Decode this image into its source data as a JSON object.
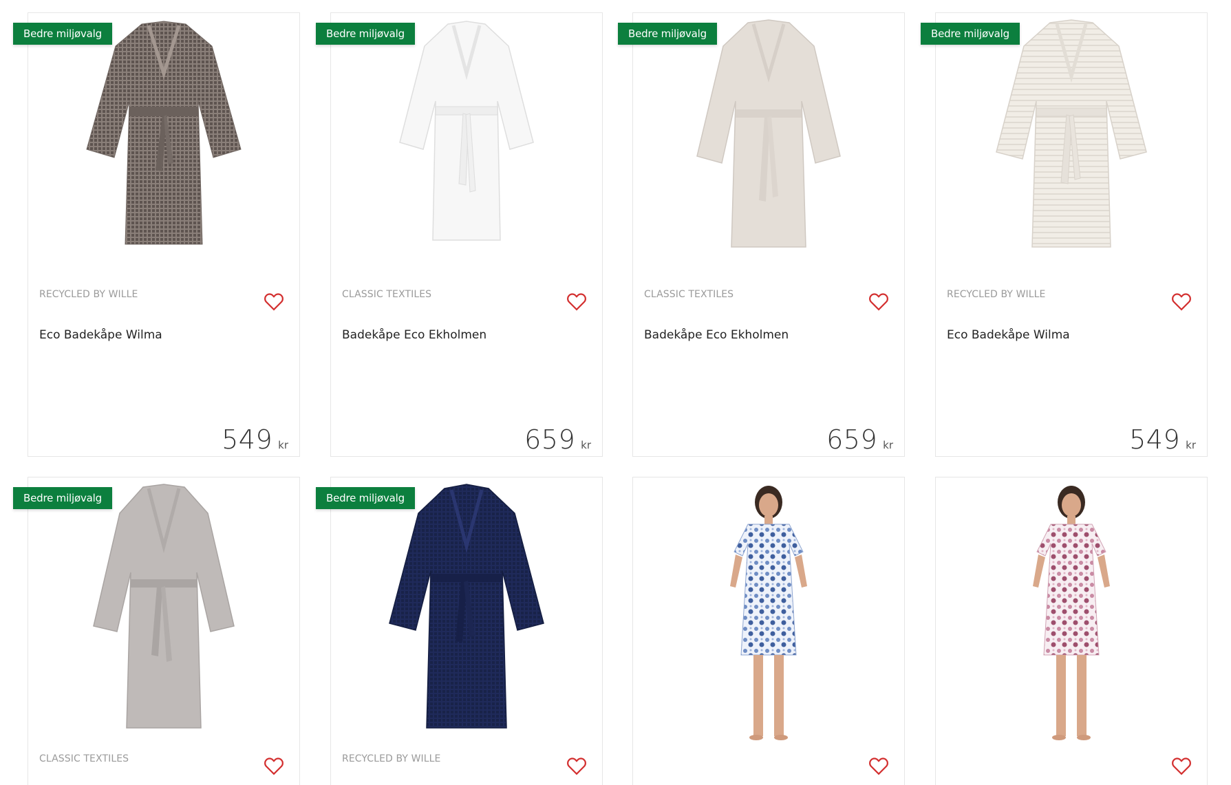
{
  "products": [
    {
      "badge": "Bedre miljøvalg",
      "brand": "RECYCLED BY WILLE",
      "name": "Eco Badekåpe Wilma",
      "price": "549",
      "currency": "kr",
      "image": "waffle-robe-brown",
      "color": "#7b6f69"
    },
    {
      "badge": "Bedre miljøvalg",
      "brand": "CLASSIC TEXTILES",
      "name": "Badekåpe Eco Ekholmen",
      "price": "659",
      "currency": "kr",
      "image": "robe-white",
      "color": "#f6f6f6"
    },
    {
      "badge": "Bedre miljøvalg",
      "brand": "CLASSIC TEXTILES",
      "name": "Badekåpe Eco Ekholmen",
      "price": "659",
      "currency": "kr",
      "image": "robe-beige",
      "color": "#e3ddd6"
    },
    {
      "badge": "Bedre miljøvalg",
      "brand": "RECYCLED BY WILLE",
      "name": "Eco Badekåpe Wilma",
      "price": "549",
      "currency": "kr",
      "image": "waffle-robe-cream",
      "color": "#efebe4"
    },
    {
      "badge": "Bedre miljøvalg",
      "brand": "CLASSIC TEXTILES",
      "image": "robe-grey",
      "color": "#bdb8b6"
    },
    {
      "badge": "Bedre miljøvalg",
      "brand": "RECYCLED BY WILLE",
      "image": "waffle-robe-navy",
      "color": "#1f2a5a"
    },
    {
      "image": "nightdress-blue-pattern",
      "color": "#7a93c4"
    },
    {
      "image": "nightdress-pink-pattern",
      "color": "#c98aa3"
    }
  ],
  "colors": {
    "badge": "#0c7f3e",
    "heart": "#d32f2f",
    "border": "#e6e6e6"
  },
  "icons": {
    "favorite": "heart-outline-icon"
  }
}
